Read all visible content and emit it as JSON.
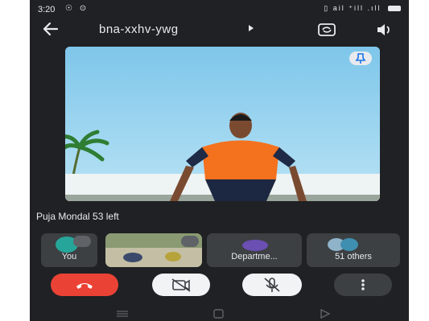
{
  "status_bar": {
    "time": "3:20",
    "left_icons": "☉ ⊙",
    "right_icons": "▯ ail ⁺ill .ıll"
  },
  "top_bar": {
    "meeting_code": "bna-xxhv-ywg",
    "back_icon": "arrow-left-icon",
    "switch_camera_icon": "switch-camera-icon",
    "speaker_icon": "speaker-icon"
  },
  "main_video": {
    "pin_icon": "pin-icon"
  },
  "participant_line": "Puja Mondal 53 left",
  "tiles": [
    {
      "label": "You"
    },
    {
      "label": ""
    },
    {
      "label": "Departme..."
    },
    {
      "label": "51 others"
    }
  ],
  "controls": {
    "end_call_icon": "end-call-icon",
    "camera_icon": "camera-off-icon",
    "mic_icon": "mic-off-icon",
    "more_icon": "more-vert-icon"
  },
  "colors": {
    "background": "#202124",
    "tile": "#3c4043",
    "end_call": "#ea4335",
    "button_light": "#f1f3f4"
  }
}
